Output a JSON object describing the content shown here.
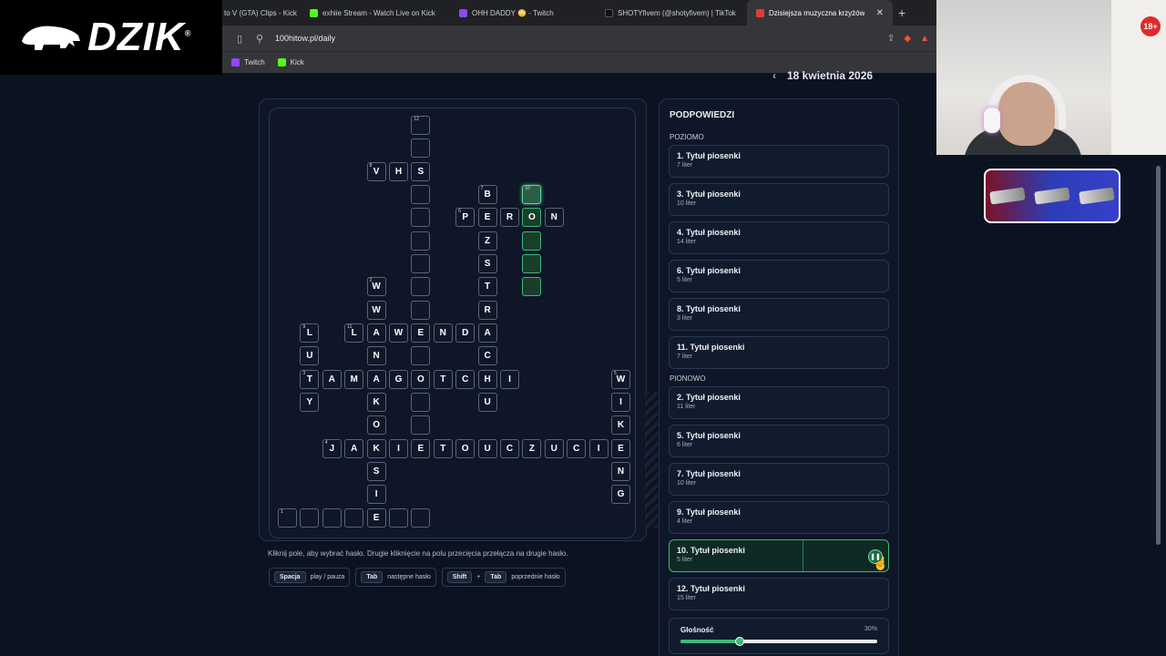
{
  "logo": {
    "text": "DZIK",
    "mark": "®"
  },
  "browser": {
    "tabs": [
      {
        "label": "to V (GTA) Clips - Kick",
        "icon": "kick-icon",
        "color": "#53fc18",
        "active": false
      },
      {
        "label": "exhiie Stream - Watch Live on Kick",
        "icon": "kick-icon",
        "color": "#53fc18",
        "active": false
      },
      {
        "label": "OHH DADDY 😳 - Twitch",
        "icon": "twitch-icon",
        "color": "#9146ff",
        "active": false
      },
      {
        "label": "SHOTYfivem (@shotyfivem) | TikTok",
        "icon": "tiktok-icon",
        "color": "#111111",
        "active": false
      },
      {
        "label": "Dzisiejsza muzyczna krzyżówk",
        "icon": "speaker-icon",
        "color": "#e23b3b",
        "active": true
      }
    ],
    "url": "100hitow.pl/daily",
    "bookmarks": [
      {
        "label": "Twitch",
        "color": "#9146ff"
      },
      {
        "label": "Kick",
        "color": "#53fc18"
      }
    ]
  },
  "overlay": {
    "age_badge": "18+"
  },
  "page": {
    "date": "18 kwietnia 2026",
    "hint_text": "Kliknij pole, aby wybrać hasło. Drugie kliknięcie na polu przecięcia przełącza na drugie hasło.",
    "shortcuts": [
      {
        "keys": [
          "Spacja"
        ],
        "desc": "play / pauza"
      },
      {
        "keys": [
          "Tab"
        ],
        "desc": "następne hasło"
      },
      {
        "keys": [
          "Shift",
          "Tab"
        ],
        "desc": "poprzednie hasło"
      }
    ]
  },
  "crossword": {
    "cells": [
      {
        "r": 0,
        "c": 6,
        "l": "",
        "n": "12"
      },
      {
        "r": 1,
        "c": 6,
        "l": ""
      },
      {
        "r": 2,
        "c": 4,
        "l": "V",
        "n": "8"
      },
      {
        "r": 2,
        "c": 5,
        "l": "H"
      },
      {
        "r": 2,
        "c": 6,
        "l": "S"
      },
      {
        "r": 3,
        "c": 6,
        "l": ""
      },
      {
        "r": 3,
        "c": 9,
        "l": "B",
        "n": "7"
      },
      {
        "r": 3,
        "c": 11,
        "l": "",
        "n": "10",
        "h": "active"
      },
      {
        "r": 4,
        "c": 6,
        "l": ""
      },
      {
        "r": 4,
        "c": 8,
        "l": "P",
        "n": "6"
      },
      {
        "r": 4,
        "c": 9,
        "l": "E"
      },
      {
        "r": 4,
        "c": 10,
        "l": "R"
      },
      {
        "r": 4,
        "c": 11,
        "l": "O",
        "h": "hl"
      },
      {
        "r": 4,
        "c": 12,
        "l": "N"
      },
      {
        "r": 5,
        "c": 6,
        "l": ""
      },
      {
        "r": 5,
        "c": 9,
        "l": "Z"
      },
      {
        "r": 5,
        "c": 11,
        "l": "",
        "h": "hl"
      },
      {
        "r": 6,
        "c": 6,
        "l": ""
      },
      {
        "r": 6,
        "c": 9,
        "l": "S"
      },
      {
        "r": 6,
        "c": 11,
        "l": "",
        "h": "hl"
      },
      {
        "r": 7,
        "c": 4,
        "l": "W",
        "n": "2"
      },
      {
        "r": 7,
        "c": 6,
        "l": ""
      },
      {
        "r": 7,
        "c": 9,
        "l": "T"
      },
      {
        "r": 7,
        "c": 11,
        "l": "",
        "h": "hl"
      },
      {
        "r": 8,
        "c": 4,
        "l": "W"
      },
      {
        "r": 8,
        "c": 6,
        "l": ""
      },
      {
        "r": 8,
        "c": 9,
        "l": "R"
      },
      {
        "r": 9,
        "c": 1,
        "l": "L",
        "n": "9"
      },
      {
        "r": 9,
        "c": 3,
        "l": "L",
        "n": "11"
      },
      {
        "r": 9,
        "c": 4,
        "l": "A"
      },
      {
        "r": 9,
        "c": 5,
        "l": "W"
      },
      {
        "r": 9,
        "c": 6,
        "l": "E"
      },
      {
        "r": 9,
        "c": 7,
        "l": "N"
      },
      {
        "r": 9,
        "c": 8,
        "l": "D"
      },
      {
        "r": 9,
        "c": 9,
        "l": "A"
      },
      {
        "r": 10,
        "c": 1,
        "l": "U"
      },
      {
        "r": 10,
        "c": 4,
        "l": "N"
      },
      {
        "r": 10,
        "c": 6,
        "l": ""
      },
      {
        "r": 10,
        "c": 9,
        "l": "C"
      },
      {
        "r": 11,
        "c": 1,
        "l": "T",
        "n": "3"
      },
      {
        "r": 11,
        "c": 2,
        "l": "A"
      },
      {
        "r": 11,
        "c": 3,
        "l": "M"
      },
      {
        "r": 11,
        "c": 4,
        "l": "A"
      },
      {
        "r": 11,
        "c": 5,
        "l": "G"
      },
      {
        "r": 11,
        "c": 6,
        "l": "O"
      },
      {
        "r": 11,
        "c": 7,
        "l": "T"
      },
      {
        "r": 11,
        "c": 8,
        "l": "C"
      },
      {
        "r": 11,
        "c": 9,
        "l": "H"
      },
      {
        "r": 11,
        "c": 10,
        "l": "I"
      },
      {
        "r": 11,
        "c": 15,
        "l": "W",
        "n": "5"
      },
      {
        "r": 12,
        "c": 1,
        "l": "Y"
      },
      {
        "r": 12,
        "c": 4,
        "l": "K"
      },
      {
        "r": 12,
        "c": 6,
        "l": ""
      },
      {
        "r": 12,
        "c": 9,
        "l": "U"
      },
      {
        "r": 12,
        "c": 15,
        "l": "I"
      },
      {
        "r": 13,
        "c": 4,
        "l": "O"
      },
      {
        "r": 13,
        "c": 6,
        "l": ""
      },
      {
        "r": 13,
        "c": 15,
        "l": "K"
      },
      {
        "r": 14,
        "c": 2,
        "l": "J",
        "n": "4"
      },
      {
        "r": 14,
        "c": 3,
        "l": "A"
      },
      {
        "r": 14,
        "c": 4,
        "l": "K"
      },
      {
        "r": 14,
        "c": 5,
        "l": "I"
      },
      {
        "r": 14,
        "c": 6,
        "l": "E"
      },
      {
        "r": 14,
        "c": 7,
        "l": "T"
      },
      {
        "r": 14,
        "c": 8,
        "l": "O"
      },
      {
        "r": 14,
        "c": 9,
        "l": "U"
      },
      {
        "r": 14,
        "c": 10,
        "l": "C"
      },
      {
        "r": 14,
        "c": 11,
        "l": "Z"
      },
      {
        "r": 14,
        "c": 12,
        "l": "U"
      },
      {
        "r": 14,
        "c": 13,
        "l": "C"
      },
      {
        "r": 14,
        "c": 14,
        "l": "I"
      },
      {
        "r": 14,
        "c": 15,
        "l": "E"
      },
      {
        "r": 15,
        "c": 4,
        "l": "S"
      },
      {
        "r": 15,
        "c": 15,
        "l": "N"
      },
      {
        "r": 16,
        "c": 4,
        "l": "I"
      },
      {
        "r": 16,
        "c": 15,
        "l": "G"
      },
      {
        "r": 17,
        "c": 0,
        "l": "",
        "n": "1"
      },
      {
        "r": 17,
        "c": 1,
        "l": ""
      },
      {
        "r": 17,
        "c": 2,
        "l": ""
      },
      {
        "r": 17,
        "c": 3,
        "l": ""
      },
      {
        "r": 17,
        "c": 4,
        "l": "E"
      },
      {
        "r": 17,
        "c": 5,
        "l": ""
      },
      {
        "r": 17,
        "c": 6,
        "l": ""
      }
    ]
  },
  "hints": {
    "title": "PODPOWIEDZI",
    "across_title": "POZIOMO",
    "across": [
      {
        "title": "1. Tytuł piosenki",
        "sub": "7 liter"
      },
      {
        "title": "3. Tytuł piosenki",
        "sub": "10 liter"
      },
      {
        "title": "4. Tytuł piosenki",
        "sub": "14 liter"
      },
      {
        "title": "6. Tytuł piosenki",
        "sub": "5 liter"
      },
      {
        "title": "8. Tytuł piosenki",
        "sub": "3 liter"
      },
      {
        "title": "11. Tytuł piosenki",
        "sub": "7 liter"
      }
    ],
    "down_title": "PIONOWO",
    "down": [
      {
        "title": "2. Tytuł piosenki",
        "sub": "11 liter"
      },
      {
        "title": "5. Tytuł piosenki",
        "sub": "6 liter"
      },
      {
        "title": "7. Tytuł piosenki",
        "sub": "10 liter"
      },
      {
        "title": "9. Tytuł piosenki",
        "sub": "4 liter"
      },
      {
        "title": "10. Tytuł piosenki",
        "sub": "5 liter",
        "active": true
      },
      {
        "title": "12. Tytuł piosenki",
        "sub": "15 liter"
      }
    ],
    "volume": {
      "label": "Głośność",
      "value": "30%",
      "level": 0.3
    }
  },
  "colors": {
    "accent": "#3cb878",
    "background": "#0c1320"
  }
}
